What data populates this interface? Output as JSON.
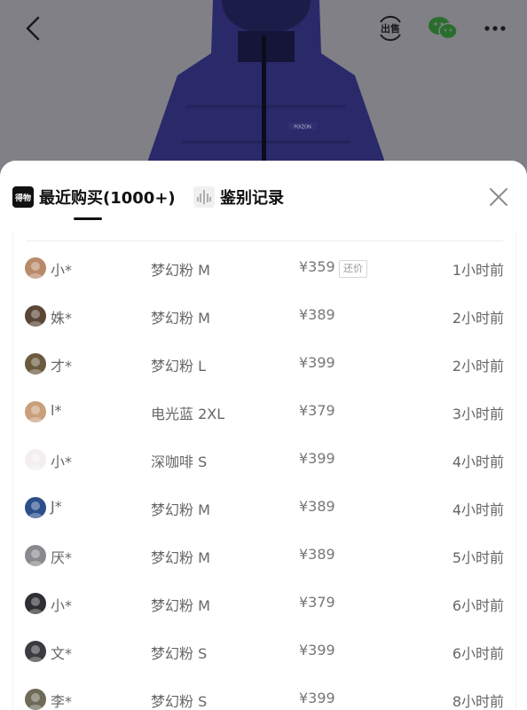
{
  "header": {
    "back_icon": "chevron-left-icon",
    "sell_icon": "sell-icon",
    "sell_icon_text": "出售",
    "wechat_icon": "wechat-icon",
    "more_icon": "more-dots-icon"
  },
  "hero": {
    "product_label": "POIZON"
  },
  "sheet": {
    "tabs": [
      {
        "label": "最近购买(1000+)",
        "icon": "dewu-logo-icon",
        "icon_text": "得物",
        "active": true
      },
      {
        "label": "鉴别记录",
        "icon": "authentication-icon",
        "active": false
      }
    ],
    "close_icon": "close-icon"
  },
  "purchases": [
    {
      "name": "小*",
      "spec": "梦幻粉 M",
      "price": "¥359",
      "badge": "还价",
      "time": "1小时前",
      "avatar_color": "#b98a6a"
    },
    {
      "name": "姝*",
      "spec": "梦幻粉 M",
      "price": "¥389",
      "badge": "",
      "time": "2小时前",
      "avatar_color": "#5a4636"
    },
    {
      "name": "才*",
      "spec": "梦幻粉 L",
      "price": "¥399",
      "badge": "",
      "time": "2小时前",
      "avatar_color": "#6b5a3e"
    },
    {
      "name": "l*",
      "spec": "电光蓝 2XL",
      "price": "¥379",
      "badge": "",
      "time": "3小时前",
      "avatar_color": "#c9a07a"
    },
    {
      "name": "小*",
      "spec": "深咖啡 S",
      "price": "¥399",
      "badge": "",
      "time": "4小时前",
      "avatar_color": "#f3eef2"
    },
    {
      "name": "J*",
      "spec": "梦幻粉 M",
      "price": "¥389",
      "badge": "",
      "time": "4小时前",
      "avatar_color": "#2c4f8c"
    },
    {
      "name": "厌*",
      "spec": "梦幻粉 M",
      "price": "¥389",
      "badge": "",
      "time": "5小时前",
      "avatar_color": "#8a8a8e"
    },
    {
      "name": "小*",
      "spec": "梦幻粉 M",
      "price": "¥379",
      "badge": "",
      "time": "6小时前",
      "avatar_color": "#2e2e33"
    },
    {
      "name": "文*",
      "spec": "梦幻粉 S",
      "price": "¥399",
      "badge": "",
      "time": "6小时前",
      "avatar_color": "#3c3c40"
    },
    {
      "name": "李*",
      "spec": "梦幻粉 S",
      "price": "¥399",
      "badge": "",
      "time": "8小时前",
      "avatar_color": "#6e6a58"
    }
  ]
}
